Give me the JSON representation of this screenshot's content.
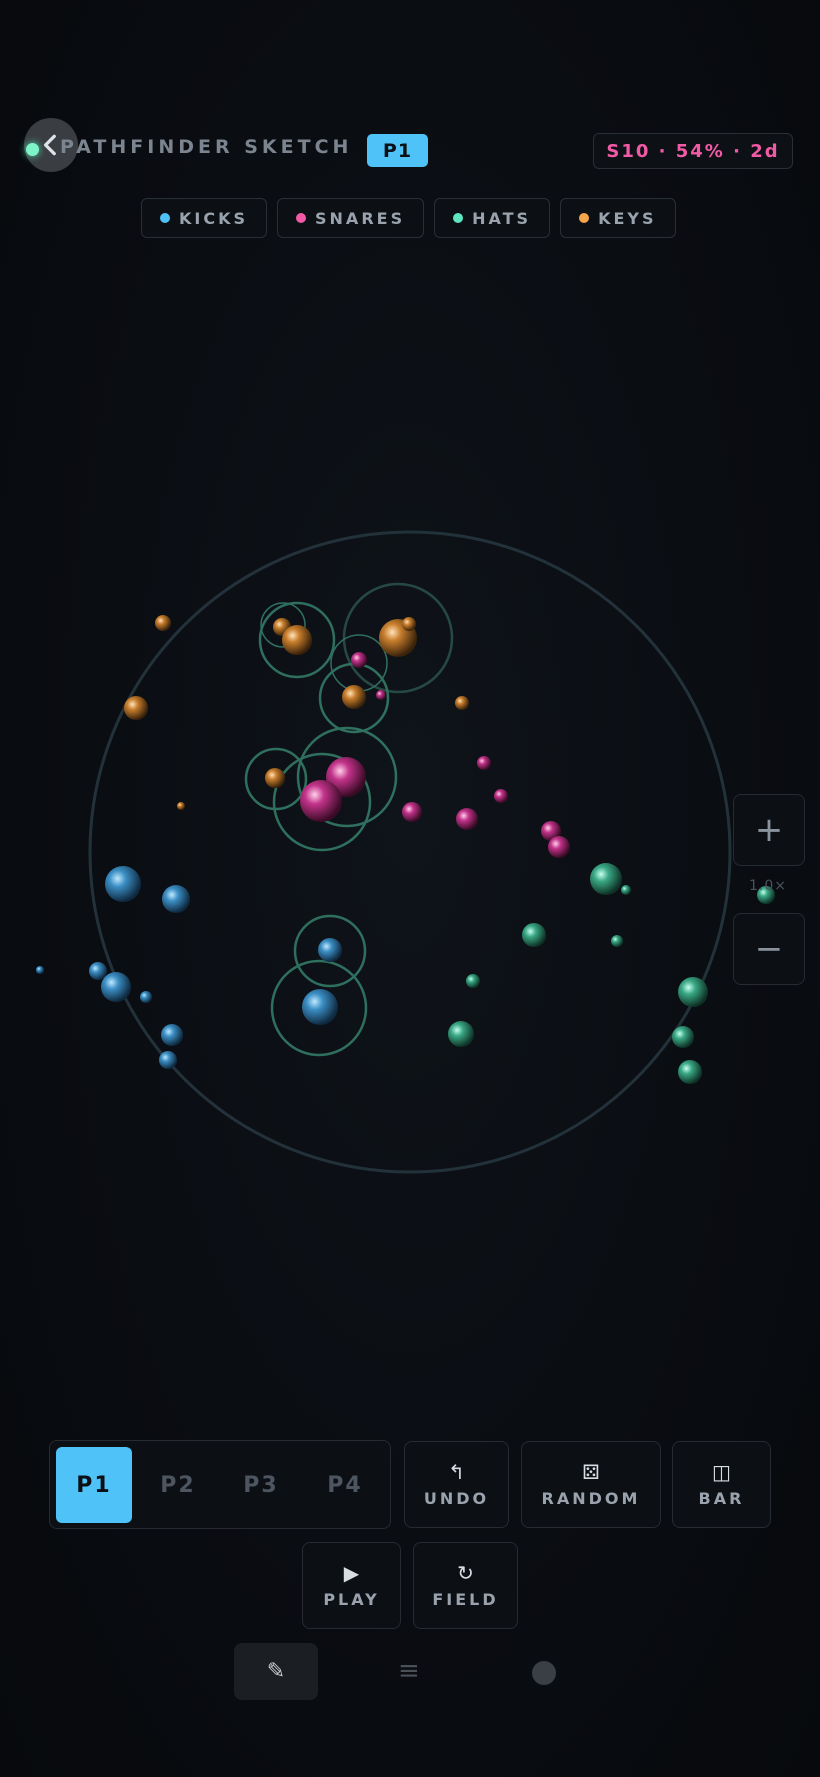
{
  "header": {
    "title": "PATHFINDER SKETCH",
    "pattern_badge": "P1",
    "stats": "S10 · 54% · 2d",
    "back_icon": "chevron-left-icon"
  },
  "legend": [
    {
      "label": "KICKS",
      "color": "#4fc3f7"
    },
    {
      "label": "SNARES",
      "color": "#f25aa5"
    },
    {
      "label": "HATS",
      "color": "#5ee6c2"
    },
    {
      "label": "KEYS",
      "color": "#f5a54a"
    }
  ],
  "zoom": {
    "plus": "+",
    "minus": "−",
    "level": "1.0×"
  },
  "pattern_tabs": [
    "P1",
    "P2",
    "P3",
    "P4"
  ],
  "active_pattern": "P1",
  "tools": {
    "undo": {
      "icon": "↰",
      "label": "UNDO"
    },
    "random": {
      "icon": "⚄",
      "label": "RANDOM"
    },
    "bar": {
      "icon": "◫",
      "label": "BAR"
    },
    "play": {
      "icon": "▶",
      "label": "PLAY"
    },
    "field": {
      "icon": "↻",
      "label": "FIELD"
    }
  },
  "bottom_nav": {
    "edit_icon": "✎",
    "menu_icon": "≡"
  }
}
